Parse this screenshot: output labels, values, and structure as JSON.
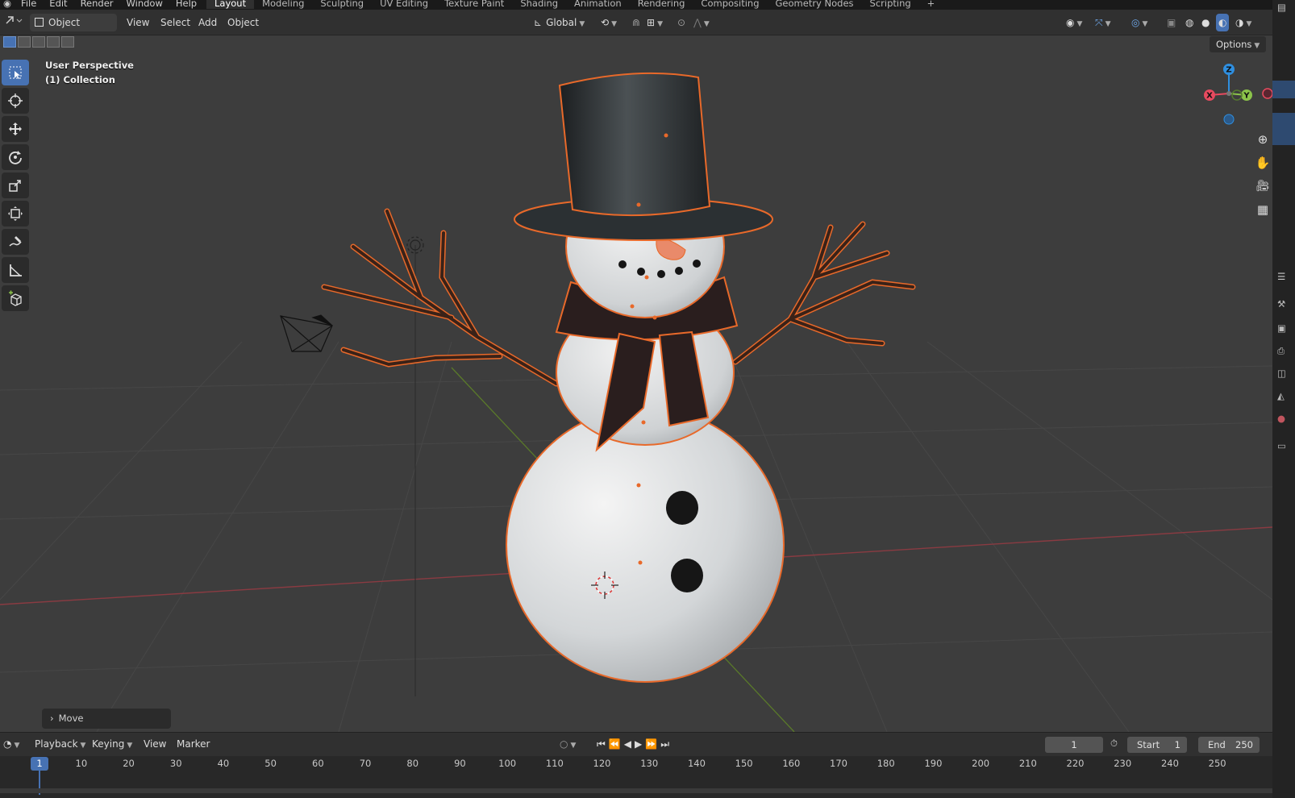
{
  "top_menu": [
    "File",
    "Edit",
    "Render",
    "Window",
    "Help"
  ],
  "workspace_tabs": [
    {
      "label": "Layout",
      "active": true
    },
    {
      "label": "Modeling",
      "active": false
    },
    {
      "label": "Sculpting",
      "active": false
    },
    {
      "label": "UV Editing",
      "active": false
    },
    {
      "label": "Texture Paint",
      "active": false
    },
    {
      "label": "Shading",
      "active": false
    },
    {
      "label": "Animation",
      "active": false
    },
    {
      "label": "Rendering",
      "active": false
    },
    {
      "label": "Compositing",
      "active": false
    },
    {
      "label": "Geometry Nodes",
      "active": false
    },
    {
      "label": "Scripting",
      "active": false
    }
  ],
  "add_workspace": "+",
  "viewport_header": {
    "mode": "Object Mode",
    "menus": [
      "View",
      "Select",
      "Add",
      "Object"
    ],
    "orientation": "Global",
    "options_label": "Options"
  },
  "viewport": {
    "perspective_label": "User Perspective",
    "collection_label": "(1) Collection",
    "last_operator": "Move"
  },
  "gizmo_axes": {
    "x": "X",
    "y": "Y",
    "z": "Z"
  },
  "toolbar_tools": [
    "select-box",
    "cursor",
    "move",
    "rotate",
    "scale",
    "transform",
    "annotate",
    "measure",
    "add-cube"
  ],
  "timeline": {
    "menus": [
      "Playback",
      "Keying",
      "View",
      "Marker"
    ],
    "current_frame": "1",
    "start_label": "Start",
    "start_value": "1",
    "end_label": "End",
    "end_value": "250",
    "playhead": "1",
    "ticks": [
      "10",
      "20",
      "30",
      "40",
      "50",
      "60",
      "70",
      "80",
      "90",
      "100",
      "110",
      "120",
      "130",
      "140",
      "150",
      "160",
      "170",
      "180",
      "190",
      "200",
      "210",
      "220",
      "230",
      "240",
      "250"
    ]
  },
  "colors": {
    "accent": "#4772b3",
    "selection_outline": "#e8692a",
    "axis_x": "#e84a5f",
    "axis_y": "#8bc34a",
    "axis_z": "#2f8fe0"
  }
}
